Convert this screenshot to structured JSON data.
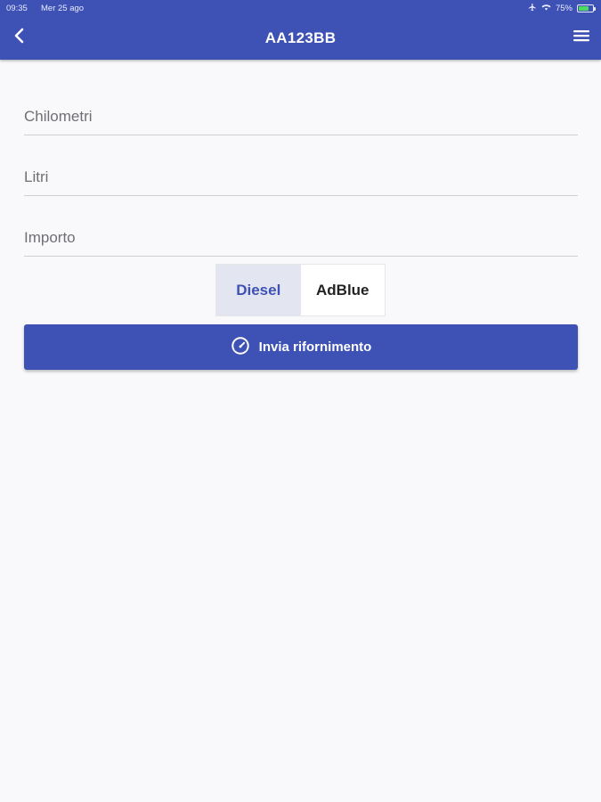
{
  "status_bar": {
    "time": "09:35",
    "date": "Mer 25 ago",
    "battery_percent": "75%",
    "battery_level": 0.75,
    "icons": [
      "airplane-icon",
      "wifi-icon",
      "battery-icon"
    ]
  },
  "header": {
    "title": "AA123BB",
    "back_icon": "chevron-left-icon",
    "menu_icon": "hamburger-menu-icon"
  },
  "form": {
    "km_placeholder": "Chilometri",
    "km_value": "",
    "liters_placeholder": "Litri",
    "liters_value": "",
    "amount_placeholder": "Importo",
    "amount_value": ""
  },
  "fuel_type": {
    "options": [
      "Diesel",
      "AdBlue"
    ],
    "selected": "Diesel"
  },
  "submit": {
    "label": "Invia rifornimento",
    "icon": "speedometer-icon"
  },
  "colors": {
    "primary": "#3e51b5",
    "background": "#f9f9fb",
    "selected_segment_bg": "#e3e5f0"
  }
}
